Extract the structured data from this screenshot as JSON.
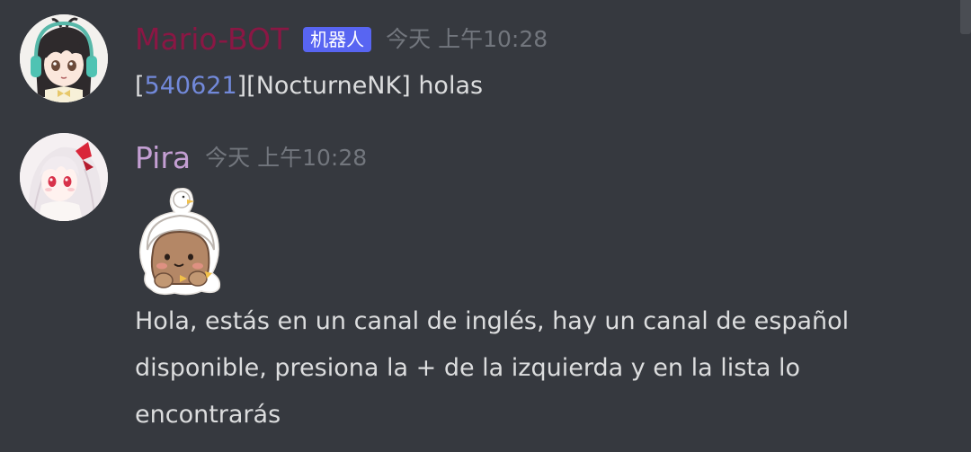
{
  "messages": [
    {
      "username": "Mario-BOT",
      "tag": "机器人",
      "timestamp": "今天 上午10:28",
      "text_open_bracket": "[",
      "mention_id": "540621",
      "text_rest": "][NocturneNK] holas",
      "avatar_icon": "anime-girl-headphones-avatar"
    },
    {
      "username": "Pira",
      "timestamp": "今天 上午10:28",
      "sticker_icon": "duck-hat-bear-sticker",
      "text": "Hola, estás en un canal de inglés, hay un canal de español disponible, presiona la + de la izquierda y en la lista lo encontrarás",
      "avatar_icon": "white-haired-anime-girl-avatar"
    }
  ],
  "colors": {
    "background": "#36393f",
    "bot_username": "#8a1744",
    "pira_username": "#c49fd3",
    "bot_tag": "#5865f2",
    "timestamp": "#72767d",
    "text": "#dcddde",
    "mention": "#7289da"
  }
}
